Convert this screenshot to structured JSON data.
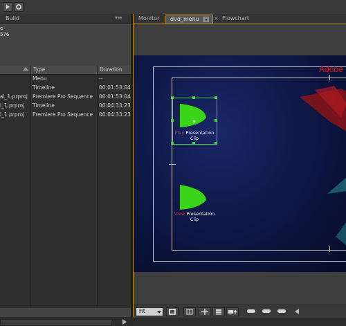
{
  "app": {
    "left_panel": {
      "tab_label": "Build",
      "panel_menu_glyph": "▾≡",
      "info_line_1": "e",
      "info_line_2": "576"
    },
    "project_table": {
      "columns": [
        "Type",
        "Duration"
      ],
      "rows": [
        {
          "name": "",
          "type": "Menu",
          "duration": "--"
        },
        {
          "name": "",
          "type": "Timeline",
          "duration": "00:01:53:04"
        },
        {
          "name": "al_1.prproj",
          "type": "Premiere Pro Sequence",
          "duration": "00:01:53:04"
        },
        {
          "name": "l_1.prproj",
          "type": "Timeline",
          "duration": "00:04:33:23"
        },
        {
          "name": "l_1.prproj",
          "type": "Premiere Pro Sequence",
          "duration": "00:04:33:23"
        }
      ]
    },
    "right_panel": {
      "tabs": [
        "Monitor",
        "dvd_menu",
        "Flowchart"
      ],
      "active_tab": "dvd_menu",
      "close_glyph": "×"
    },
    "canvas": {
      "brand_text": "Adobe",
      "buttons": [
        {
          "highlight": "Play",
          "label_line1": "Presentation",
          "label_line2": "Clip",
          "selected": true
        },
        {
          "highlight": "View",
          "label_line1": "Presentation",
          "label_line2": "Clip",
          "selected": false
        }
      ]
    },
    "bottom_bar": {
      "zoom_select": "Fit"
    },
    "icons": {
      "top": [
        "play-icon",
        "settings-icon"
      ],
      "bottom": [
        "safe-area-icon",
        "grid-icon",
        "move-icon",
        "list-icon",
        "add-icon",
        "zoom-out-icon",
        "zoom-icon",
        "zoom-in-icon"
      ]
    },
    "colors": {
      "accent": "#c58b23",
      "selection": "#3fd13f",
      "button_shape": "#3ad51a",
      "brand_red": "#e0141c"
    }
  }
}
